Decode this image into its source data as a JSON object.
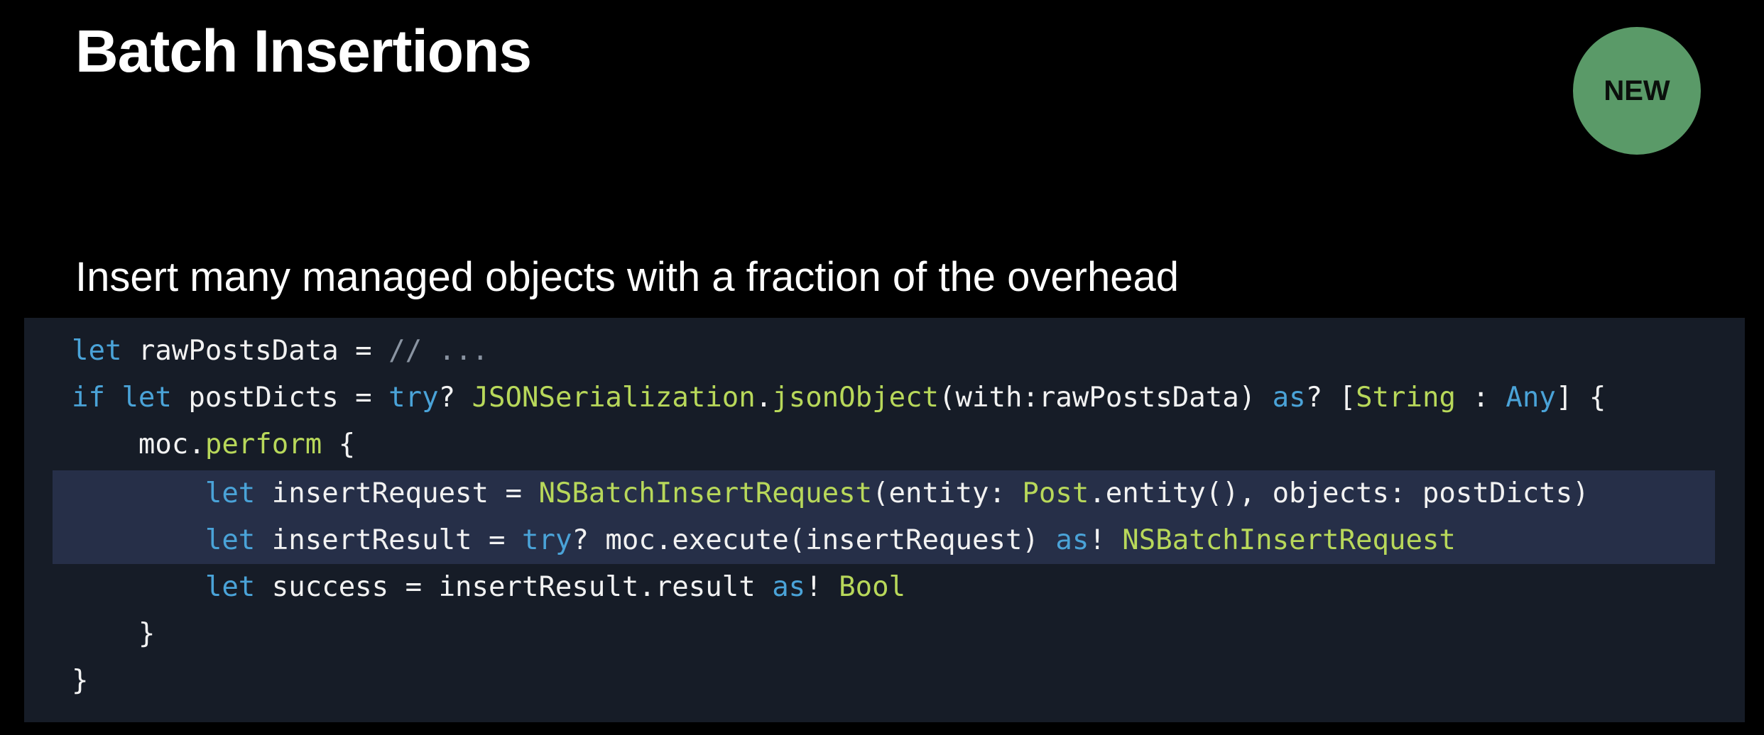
{
  "slide": {
    "title": "Batch Insertions",
    "badge": "NEW",
    "subtitle": "Insert many managed objects with a fraction of the overhead"
  },
  "colors": {
    "background": "#000000",
    "code_background": "#161c27",
    "highlight_background": "#262f48",
    "badge_green": "#5a9a68",
    "keyword": "#4aa3d8",
    "type": "#b8d85a",
    "comment": "#8a94a2",
    "plain": "#f2f2f2"
  },
  "code": {
    "lines": [
      {
        "tokens": [
          {
            "t": "let",
            "c": "kw"
          },
          {
            "t": " rawPostsData = ",
            "c": "pl"
          },
          {
            "t": "// ...",
            "c": "cm"
          }
        ]
      },
      {
        "tokens": [
          {
            "t": "if",
            "c": "kw"
          },
          {
            "t": " ",
            "c": "pl"
          },
          {
            "t": "let",
            "c": "kw"
          },
          {
            "t": " postDicts = ",
            "c": "pl"
          },
          {
            "t": "try",
            "c": "kw"
          },
          {
            "t": "? ",
            "c": "pl"
          },
          {
            "t": "JSONSerialization",
            "c": "type"
          },
          {
            "t": ".",
            "c": "pl"
          },
          {
            "t": "jsonObject",
            "c": "fn"
          },
          {
            "t": "(with:rawPostsData) ",
            "c": "pl"
          },
          {
            "t": "as",
            "c": "kw"
          },
          {
            "t": "? [",
            "c": "pl"
          },
          {
            "t": "String",
            "c": "type"
          },
          {
            "t": " : ",
            "c": "pl"
          },
          {
            "t": "Any",
            "c": "kw"
          },
          {
            "t": "] {",
            "c": "pl"
          }
        ]
      },
      {
        "tokens": [
          {
            "t": "    moc.",
            "c": "pl"
          },
          {
            "t": "perform",
            "c": "fn"
          },
          {
            "t": " {",
            "c": "pl"
          }
        ]
      },
      {
        "tokens": [
          {
            "t": "        ",
            "c": "pl"
          },
          {
            "t": "let",
            "c": "kw"
          },
          {
            "t": " insertRequest = ",
            "c": "pl"
          },
          {
            "t": "NSBatchInsertRequest",
            "c": "type"
          },
          {
            "t": "(entity: ",
            "c": "pl"
          },
          {
            "t": "Post",
            "c": "type"
          },
          {
            "t": ".entity(), objects: postDicts)",
            "c": "pl"
          }
        ]
      },
      {
        "tokens": [
          {
            "t": "        ",
            "c": "pl"
          },
          {
            "t": "let",
            "c": "kw"
          },
          {
            "t": " insertResult = ",
            "c": "pl"
          },
          {
            "t": "try",
            "c": "kw"
          },
          {
            "t": "? moc.execute(insertRequest) ",
            "c": "pl"
          },
          {
            "t": "as",
            "c": "kw"
          },
          {
            "t": "! ",
            "c": "pl"
          },
          {
            "t": "NSBatchInsertRequest",
            "c": "type"
          }
        ]
      },
      {
        "tokens": [
          {
            "t": "        ",
            "c": "pl"
          },
          {
            "t": "let",
            "c": "kw"
          },
          {
            "t": " success = insertResult.result ",
            "c": "pl"
          },
          {
            "t": "as",
            "c": "kw"
          },
          {
            "t": "! ",
            "c": "pl"
          },
          {
            "t": "Bool",
            "c": "type"
          }
        ]
      },
      {
        "tokens": [
          {
            "t": "    }",
            "c": "pl"
          }
        ]
      },
      {
        "tokens": [
          {
            "t": "}",
            "c": "pl"
          }
        ]
      }
    ],
    "highlighted_lines": [
      3,
      4
    ]
  }
}
